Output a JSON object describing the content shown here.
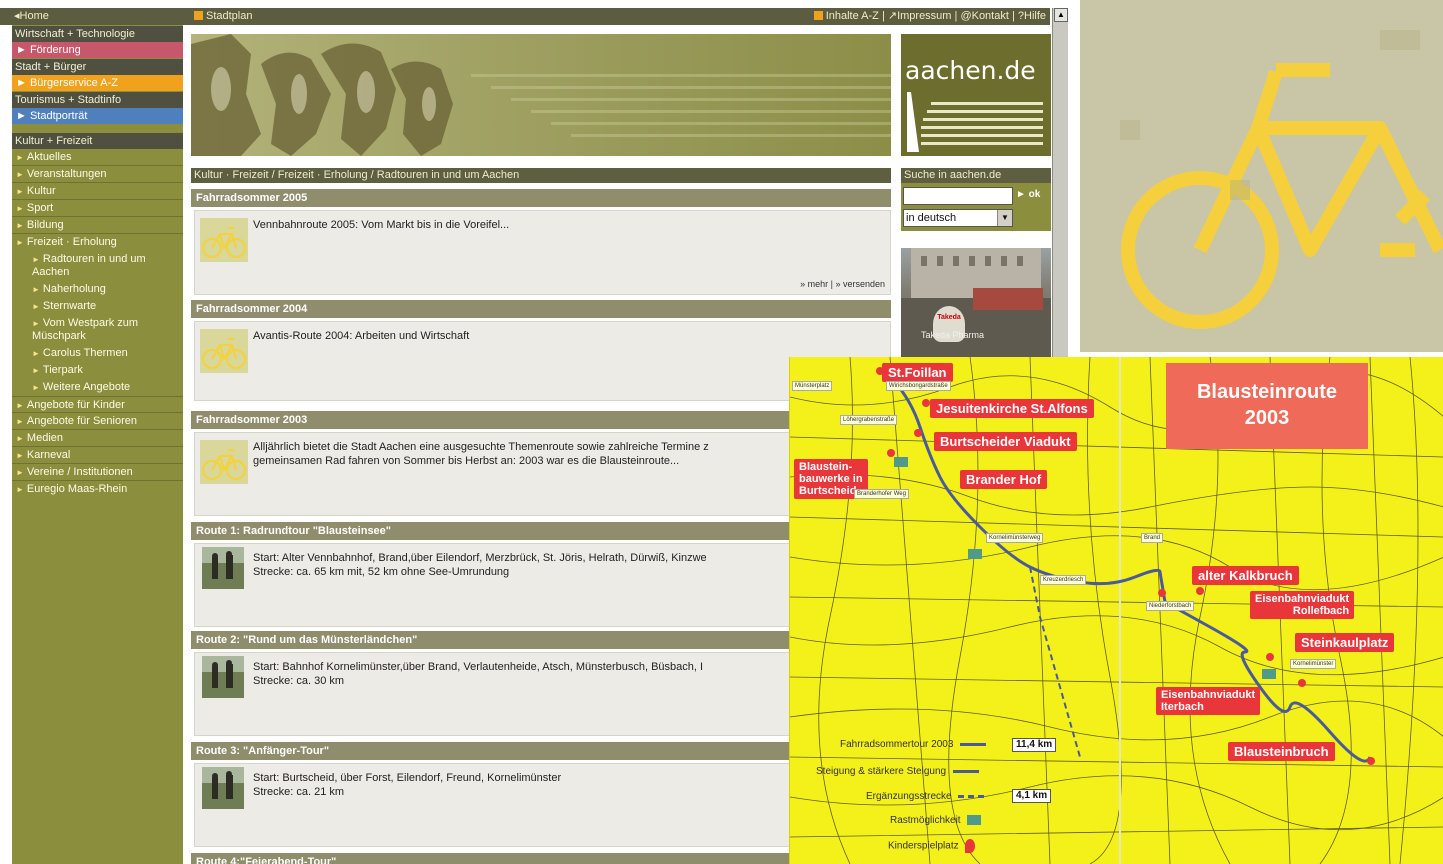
{
  "topbar": {
    "home": "◂Home",
    "stadtplan": "Stadtplan",
    "links": "Inhalte A-Z | ↗Impressum | @Kontakt | ?Hilfe"
  },
  "leftnav": {
    "groups": [
      {
        "head": "Wirtschaft + Technologie",
        "item": "► Förderung",
        "color": "#c7586c"
      },
      {
        "head": "Stadt + Bürger",
        "item": "► Bürgerservice A-Z",
        "color": "#f0a21c"
      },
      {
        "head": "Tourismus + Stadtinfo",
        "item": "► Stadtporträt",
        "color": "#4f80bd"
      }
    ],
    "section": "Kultur + Freizeit",
    "items": [
      "Aktuelles",
      "Veranstaltungen",
      "Kultur",
      "Sport",
      "Bildung",
      "Freizeit · Erholung"
    ],
    "subitems": [
      "Radtouren in und um Aachen",
      "Naherholung",
      "Sternwarte",
      "Vom Westpark zum Müschpark",
      "Carolus Thermen",
      "Tierpark",
      "Weitere Angebote"
    ],
    "items2": [
      "Angebote für Kinder",
      "Angebote für Senioren",
      "Medien",
      "Karneval",
      "Vereine / Institutionen",
      "Euregio Maas-Rhein"
    ]
  },
  "logo": "aachen.de",
  "breadcrumb": "Kultur · Freizeit / Freizeit · Erholung / Radtouren in und um Aachen",
  "sections": [
    {
      "head": "Fahrradsommer 2005",
      "text": "Vennbahnroute 2005: Vom Markt bis in die Voreifel...",
      "links": "» mehr | » versenden"
    },
    {
      "head": "Fahrradsommer 2004",
      "text": "Avantis-Route 2004: Arbeiten und Wirtschaft"
    },
    {
      "head": "Fahrradsommer 2003",
      "text": "Alljährlich bietet die Stadt Aachen eine ausgesuchte Themenroute sowie zahlreiche Termine z",
      "text2": "gemeinsamen Rad fahren von Sommer bis Herbst an: 2003 war es die Blausteinroute..."
    },
    {
      "head": "Route 1: Radrundtour \"Blausteinsee\"",
      "text": "Start: Alter Vennbahnhof, Brand,über Eilendorf, Merzbrück, St. Jöris, Helrath, Dürwiß, Kinzwe",
      "text2": "Strecke: ca. 65 km mit, 52 km ohne See-Umrundung"
    },
    {
      "head": "Route 2: \"Rund um das Münsterländchen\"",
      "text": "Start: Bahnhof Kornelimünster,über Brand, Verlautenheide, Atsch, Münsterbusch, Büsbach, I",
      "text2": "Strecke: ca. 30 km"
    },
    {
      "head": "Route 3: \"Anfänger-Tour\"",
      "text": "Start: Burtscheid, über Forst, Eilendorf, Freund, Kornelimünster",
      "text2": "Strecke: ca. 21 km"
    },
    {
      "head": "Route 4:\"Feierabend-Tour\""
    }
  ],
  "search": {
    "head": "Suche in aachen.de",
    "ok": "► ok",
    "lang": "in deutsch",
    "placeholder": ""
  },
  "promo": {
    "sign": "Takeda",
    "caption": "Takeda Pharma"
  },
  "map": {
    "title_line1": "Blausteinroute",
    "title_line2": "2003",
    "labels": [
      "St.Foillan",
      "Jesuitenkirche St.Alfons",
      "Burtscheider Viadukt",
      "Brander Hof",
      "alter Kalkbruch",
      "Steinkaulplatz",
      "Blausteinbruch"
    ],
    "small_labels": {
      "bauwerke": "Blaustein-\nbauwerke in\nBurtscheid",
      "rollefbach": "Eisenbahnviadukt\nRollefbach",
      "iterbach": "Eisenbahnviadukt\nIterbach"
    },
    "streets": [
      "Münsterplatz",
      "Wirichsbongardstraße",
      "Löhergrabenstraße",
      "Branderhofer Weg",
      "Kornelimünsterweg",
      "Kreuzerdriesch",
      "Brand",
      "Niederforstbach",
      "Kornelimünster"
    ],
    "legend": [
      {
        "label": "Fahrradsommertour 2003",
        "value": "11,4 km"
      },
      {
        "label": "Steigung & stärkere Steigung"
      },
      {
        "label": "Ergänzungsstrecke",
        "value": "4,1 km"
      },
      {
        "label": "Rastmöglichkeit"
      },
      {
        "label": "Kinderspielplatz"
      }
    ]
  }
}
